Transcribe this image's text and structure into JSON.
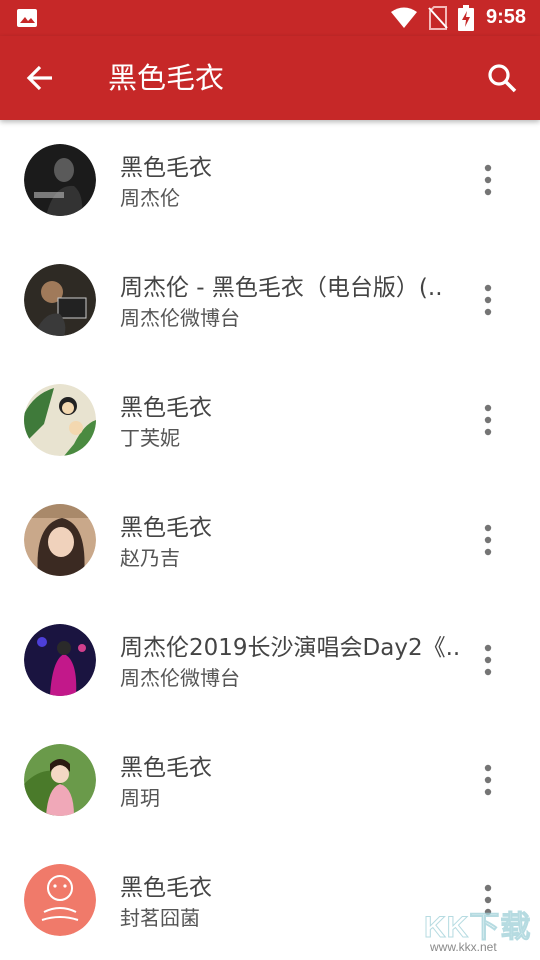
{
  "status_bar": {
    "time": "9:58",
    "icons": [
      "gallery-icon",
      "wifi-icon",
      "no-sim-icon",
      "battery-charging-icon"
    ]
  },
  "app_bar": {
    "title": "黑色毛衣",
    "back_icon": "arrow-left-icon",
    "search_icon": "search-icon",
    "color": "#c62828"
  },
  "results": [
    {
      "title": "黑色毛衣",
      "artist": "周杰伦",
      "avatar_colors": [
        "#1b1b1b",
        "#6b6b6b"
      ]
    },
    {
      "title": "周杰伦 - 黑色毛衣（电台版）(..",
      "artist": "周杰伦微博台",
      "avatar_colors": [
        "#2e2a24",
        "#8a6a4a"
      ]
    },
    {
      "title": "黑色毛衣",
      "artist": "丁芙妮",
      "avatar_colors": [
        "#3f7a3a",
        "#e8e3d0"
      ]
    },
    {
      "title": "黑色毛衣",
      "artist": "赵乃吉",
      "avatar_colors": [
        "#b78a6a",
        "#3b2a22"
      ]
    },
    {
      "title": "周杰伦2019长沙演唱会Day2《..",
      "artist": "周杰伦微博台",
      "avatar_colors": [
        "#1a1440",
        "#c2188a"
      ]
    },
    {
      "title": "黑色毛衣",
      "artist": "周玥",
      "avatar_colors": [
        "#5a8a3a",
        "#f0a8b8"
      ]
    },
    {
      "title": "黑色毛衣",
      "artist": "封茗囧菌",
      "avatar_colors": [
        "#f07a6a",
        "#ffffff"
      ]
    }
  ],
  "watermark": {
    "text": "KK下载",
    "url": "www.kkx.net"
  }
}
